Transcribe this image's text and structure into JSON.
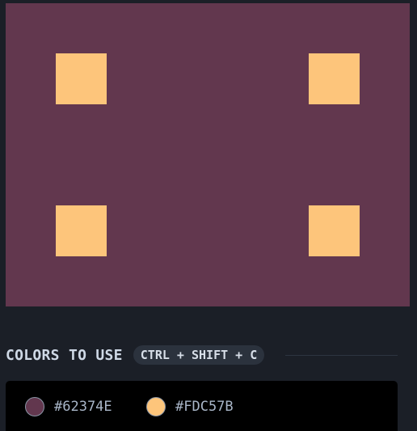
{
  "target": {
    "background": "#62374E",
    "square_color": "#FDC57B"
  },
  "header": {
    "title": "COLORS TO USE",
    "shortcut": "CTRL + SHIFT + C"
  },
  "palette": [
    {
      "hex": "#62374E"
    },
    {
      "hex": "#FDC57B"
    }
  ]
}
